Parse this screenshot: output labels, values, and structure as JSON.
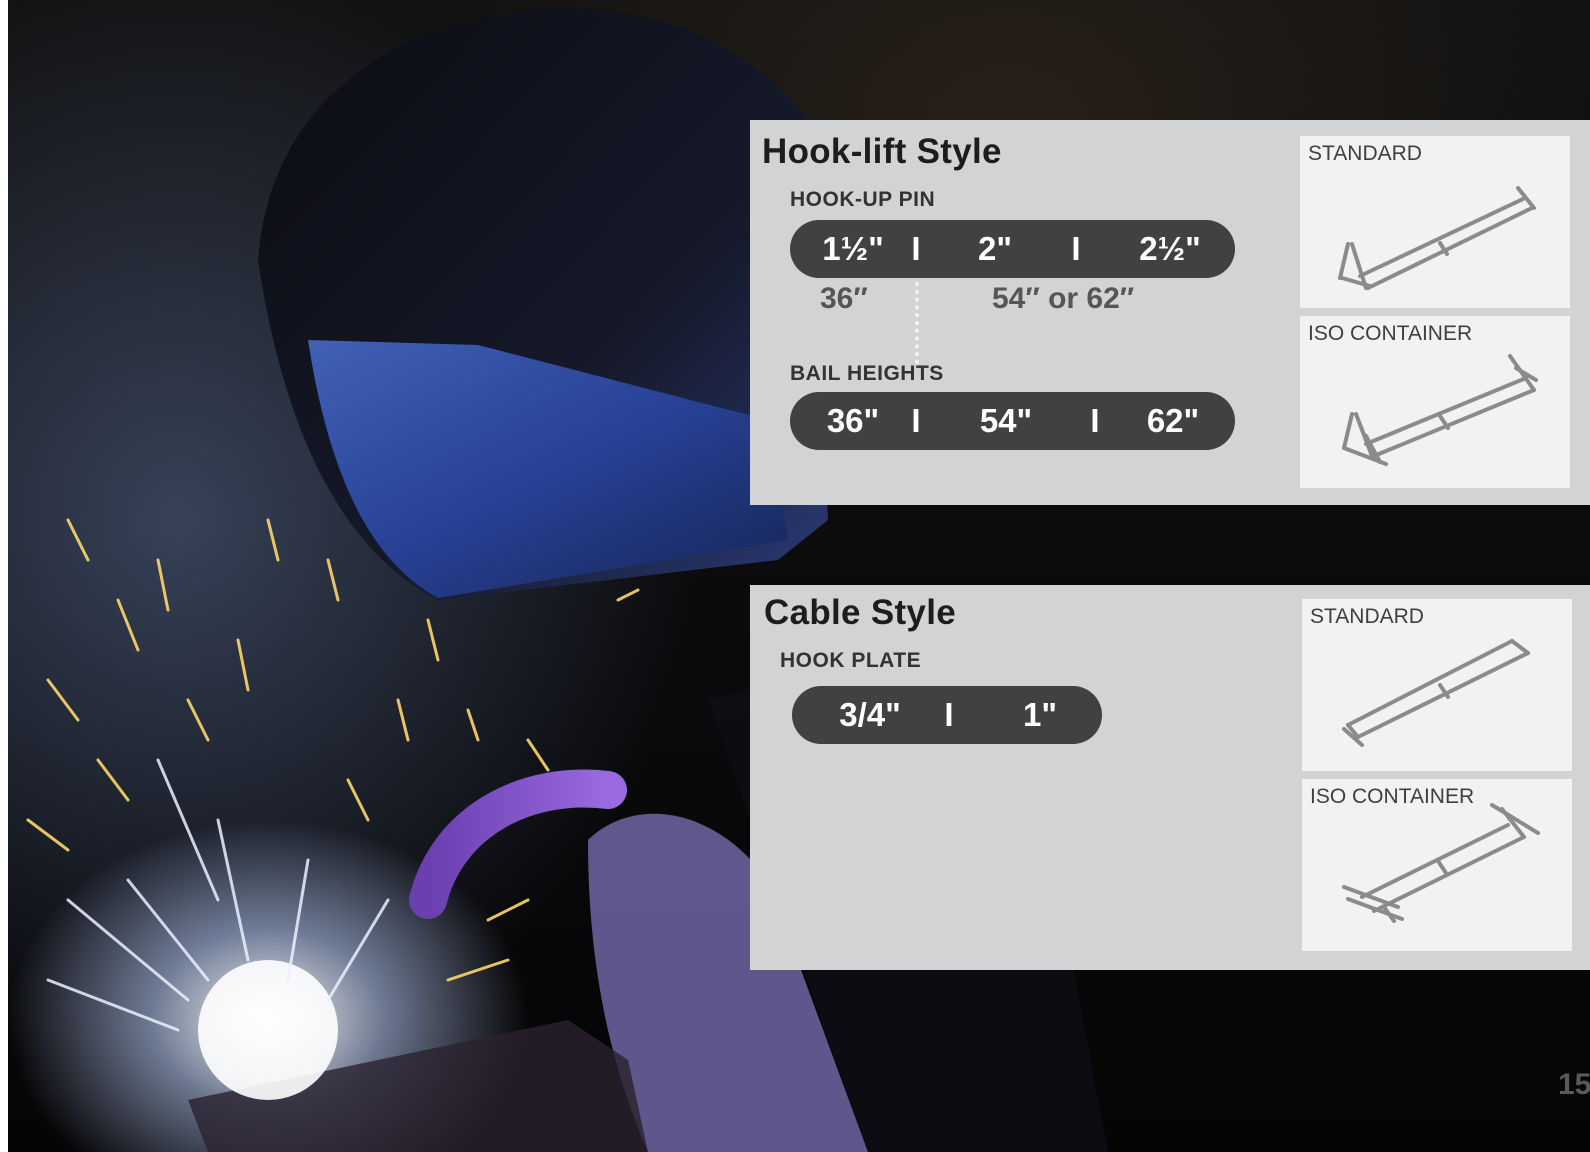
{
  "hook_lift": {
    "title": "Hook-lift Style",
    "pin_label": "HOOK-UP PIN",
    "pin_sizes": [
      "1½\"",
      "2\"",
      "2½\""
    ],
    "pin_sep": "I",
    "pin_heights": [
      "36″",
      "54″ or 62″"
    ],
    "bail_label": "BAIL HEIGHTS",
    "bail_sizes": [
      "36\"",
      "54\"",
      "62\""
    ],
    "bail_sep": "I",
    "thumbs": [
      "STANDARD",
      "ISO CONTAINER"
    ]
  },
  "cable": {
    "title": "Cable Style",
    "plate_label": "HOOK PLATE",
    "plate_sizes": [
      "3/4\"",
      "1\""
    ],
    "plate_sep": "I",
    "thumbs": [
      "STANDARD",
      "ISO CONTAINER"
    ]
  },
  "page_number": "15"
}
